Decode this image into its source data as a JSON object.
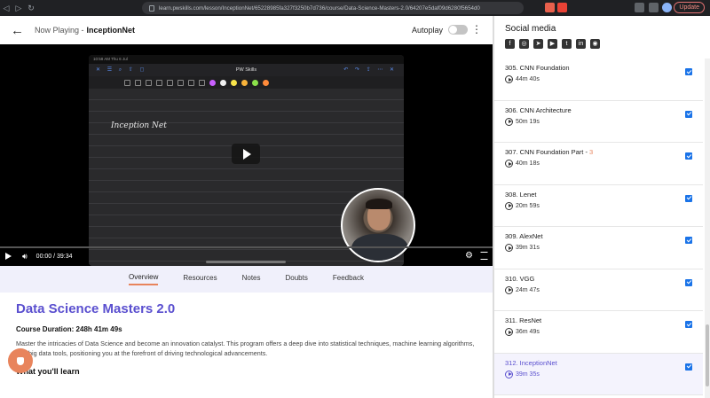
{
  "browser": {
    "url": "learn.pwskills.com/lesson/InceptionNet/65228985fa327f3250b7d736/course/Data-Science-Masters-2.0/64207e5daf09d6280f5654d0",
    "update_label": "Update"
  },
  "header": {
    "now_playing_label": "Now Playing -",
    "now_playing_title": "InceptionNet",
    "autoplay_label": "Autoplay"
  },
  "video": {
    "tablet_status": "10:58 AM  Thu 6 Jul",
    "app_title": "PW Skills",
    "handwriting": "Inception Net",
    "current_time": "00:00 / 39:34",
    "progress_fraction": 0.0
  },
  "tabs": [
    {
      "label": "Overview",
      "active": true
    },
    {
      "label": "Resources",
      "active": false
    },
    {
      "label": "Notes",
      "active": false
    },
    {
      "label": "Doubts",
      "active": false
    },
    {
      "label": "Feedback",
      "active": false
    }
  ],
  "course": {
    "title": "Data Science Masters 2.0",
    "duration": "Course Duration: 248h 41m 49s",
    "summary": "Master the intricacies of Data Science and become an innovation catalyst. This program offers a deep dive into statistical techniques, machine learning algorithms, and big data tools, positioning you at the forefront of driving technological advancements.",
    "learn_heading": "What you'll learn"
  },
  "sidebar": {
    "social_title": "Social media",
    "social_icons": [
      "facebook-icon",
      "instagram-icon",
      "telegram-icon",
      "youtube-icon",
      "twitter-icon",
      "linkedin-icon",
      "discord-icon"
    ],
    "lessons": [
      {
        "name": "305. CNN Foundation",
        "accent": "",
        "time": "44m 40s",
        "current": false
      },
      {
        "name": "306. CNN Architecture",
        "accent": "",
        "time": "50m 19s",
        "current": false
      },
      {
        "name": "307. CNN Foundation Part - ",
        "accent": "3",
        "time": "40m 18s",
        "current": false
      },
      {
        "name": "308. Lenet",
        "accent": "",
        "time": "20m 59s",
        "current": false
      },
      {
        "name": "309. AlexNet",
        "accent": "",
        "time": "39m 31s",
        "current": false
      },
      {
        "name": "310. VGG",
        "accent": "",
        "time": "24m 47s",
        "current": false
      },
      {
        "name": "311. ResNet",
        "accent": "",
        "time": "36m 49s",
        "current": false
      },
      {
        "name": "312. InceptionNet",
        "accent": "",
        "time": "39m 35s",
        "current": true
      }
    ]
  },
  "colors": {
    "brand_purple": "#5a4fcf",
    "accent_orange": "#e8845c",
    "check_blue": "#1a73e8"
  }
}
